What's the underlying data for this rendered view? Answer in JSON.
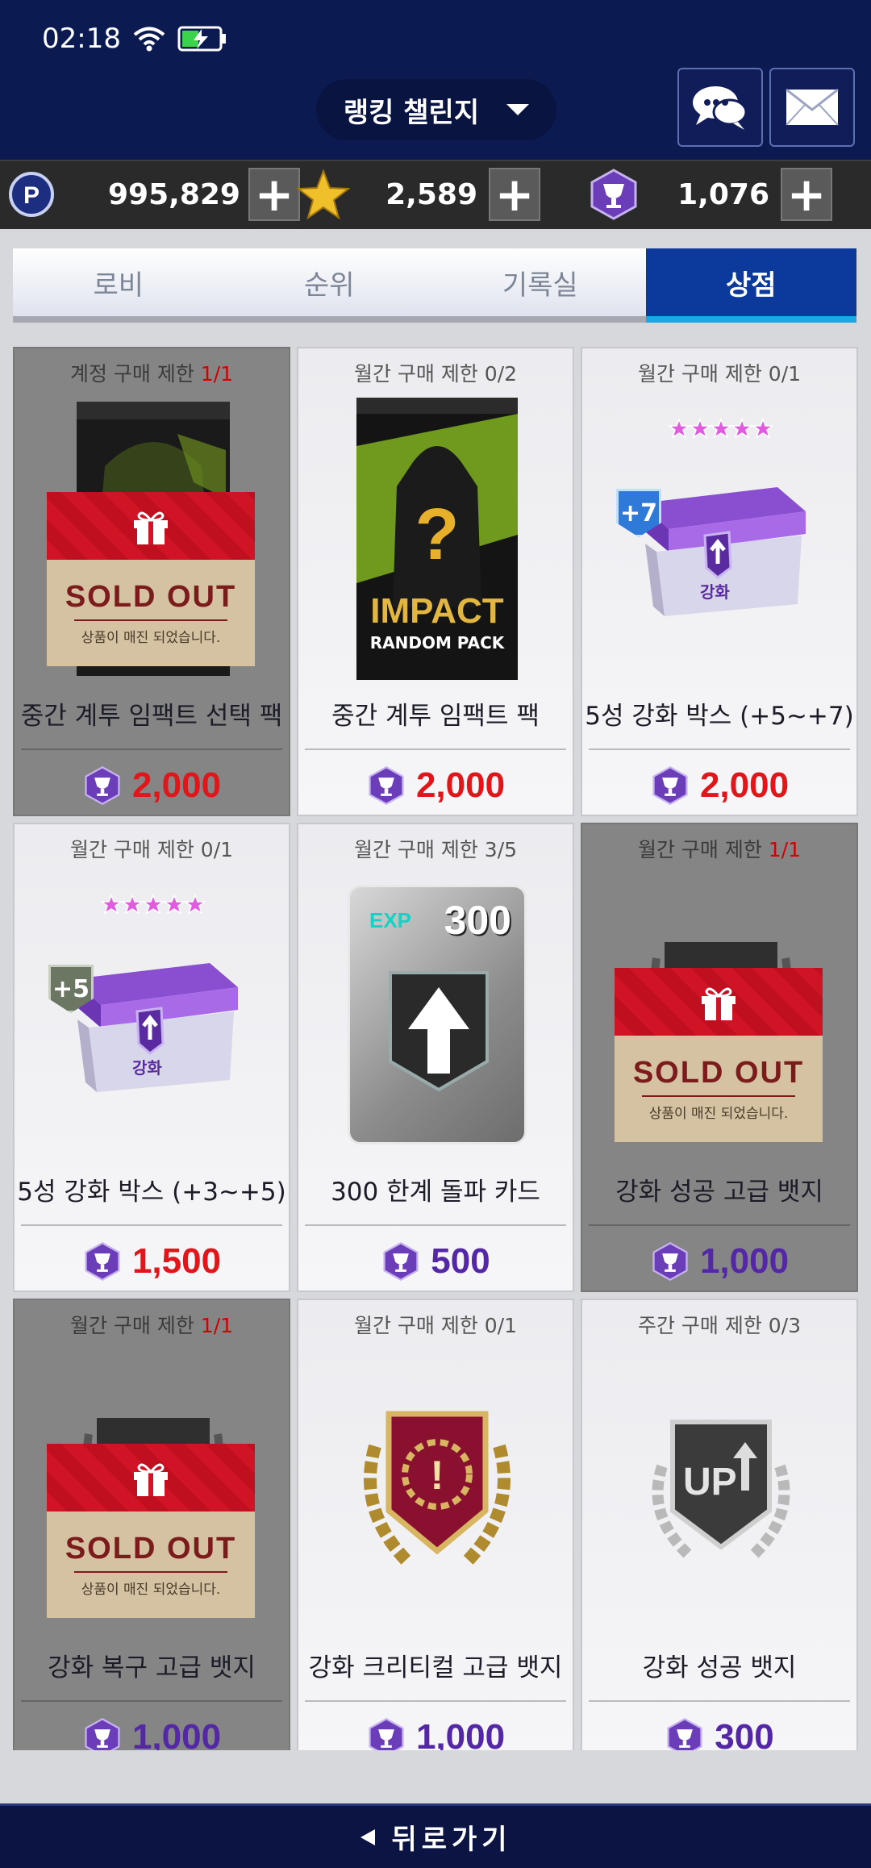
{
  "status": {
    "time": "02:18"
  },
  "header": {
    "title": "랭킹 챌린지"
  },
  "currency": [
    {
      "value": "995,829",
      "icon": "p-coin-icon"
    },
    {
      "value": "2,589",
      "icon": "star-icon"
    },
    {
      "value": "1,076",
      "icon": "trophy-gem-icon"
    }
  ],
  "tabs": [
    {
      "label": "로비"
    },
    {
      "label": "순위"
    },
    {
      "label": "기록실"
    },
    {
      "label": "상점"
    }
  ],
  "cards": [
    {
      "limit_prefix": "계정 구매 제한 ",
      "limit_used": "1",
      "limit_sep": "/",
      "limit_total": "1",
      "name": "중간 계투 임팩트 선택 팩",
      "price": "2,000",
      "sold_out": true
    },
    {
      "limit_prefix": "월간 구매 제한 ",
      "limit_used": "0",
      "limit_sep": "/",
      "limit_total": "2",
      "name": "중간 계투 임팩트 팩",
      "price": "2,000",
      "pack_big": "IMPACT",
      "pack_small": "RANDOM PACK"
    },
    {
      "limit_prefix": "월간 구매 제한 ",
      "limit_used": "0",
      "limit_sep": "/",
      "limit_total": "1",
      "name": "5성 강화 박스 (+5~+7)",
      "price": "2,000",
      "box_badge": "+7",
      "box_label": "강화"
    },
    {
      "limit_prefix": "월간 구매 제한 ",
      "limit_used": "0",
      "limit_sep": "/",
      "limit_total": "1",
      "name": "5성 강화 박스 (+3~+5)",
      "price": "1,500",
      "box_badge": "+5",
      "box_label": "강화"
    },
    {
      "limit_prefix": "월간 구매 제한 ",
      "limit_used": "3",
      "limit_sep": "/",
      "limit_total": "5",
      "name": "300 한계 돌파 카드",
      "price": "500",
      "exp_tag": "EXP",
      "exp_value": "300"
    },
    {
      "limit_prefix": "월간 구매 제한 ",
      "limit_used": "1",
      "limit_sep": "/",
      "limit_total": "1",
      "name": "강화 성공 고급 뱃지",
      "price": "1,000",
      "sold_out": true
    },
    {
      "limit_prefix": "월간 구매 제한 ",
      "limit_used": "1",
      "limit_sep": "/",
      "limit_total": "1",
      "name": "강화 복구 고급 뱃지",
      "price": "1,000",
      "sold_out": true
    },
    {
      "limit_prefix": "월간 구매 제한 ",
      "limit_used": "0",
      "limit_sep": "/",
      "limit_total": "1",
      "name": "강화 크리티컬 고급 뱃지",
      "price": "1,000"
    },
    {
      "limit_prefix": "주간 구매 제한 ",
      "limit_used": "0",
      "limit_sep": "/",
      "limit_total": "3",
      "name": "강화 성공 뱃지",
      "price": "300",
      "badge_text": "UP"
    }
  ],
  "sold_out": {
    "title": "SOLD OUT",
    "subtitle": "상품이 매진 되었습니다."
  },
  "footer": {
    "back_label": "뒤로가기"
  }
}
